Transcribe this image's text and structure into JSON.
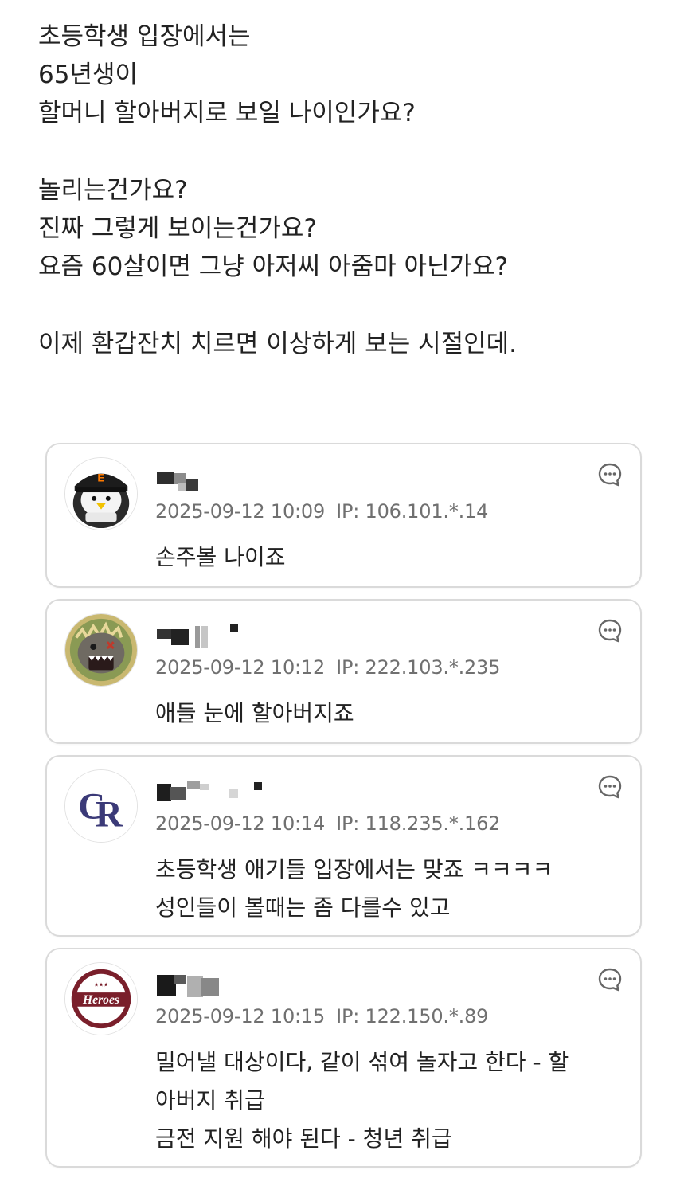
{
  "post": {
    "lines": [
      "초등학생 입장에서는",
      "65년생이",
      "할머니 할아버지로 보일 나이인가요?",
      "",
      "놀리는건가요?",
      "진짜 그렇게 보이는건가요?",
      "요즘 60살이면 그냥 아저씨 아줌마 아닌가요?",
      "",
      "이제 환갑잔치 치르면 이상하게 보는 시절인데."
    ]
  },
  "comments": [
    {
      "date": "2025-09-12 10:09",
      "ip": "IP: 106.101.*.14",
      "avatar": "eagle-mascot-icon",
      "text": [
        "손주볼 나이죠"
      ]
    },
    {
      "date": "2025-09-12 10:12",
      "ip": "IP: 222.103.*.235",
      "avatar": "dinosaur-mascot-icon",
      "text": [
        "애들 눈에 할아버지죠"
      ]
    },
    {
      "date": "2025-09-12 10:14",
      "ip": "IP: 118.235.*.162",
      "avatar": "cr-logo-icon",
      "text": [
        "초등학생 애기들 입장에서는 맞죠 ㅋㅋㅋㅋ",
        "성인들이 볼때는 좀 다를수 있고"
      ]
    },
    {
      "date": "2025-09-12 10:15",
      "ip": "IP: 122.150.*.89",
      "avatar": "heroes-logo-icon",
      "text": [
        "밀어낼 대상이다, 같이 섞여 놀자고 한다 - 할",
        "아버지 취급",
        "금전 지원 해야 된다 - 청년 취급"
      ]
    }
  ],
  "colors": {
    "text": "#222222",
    "meta": "#707070",
    "card_border": "#dadada",
    "reply_icon": "#666666"
  }
}
